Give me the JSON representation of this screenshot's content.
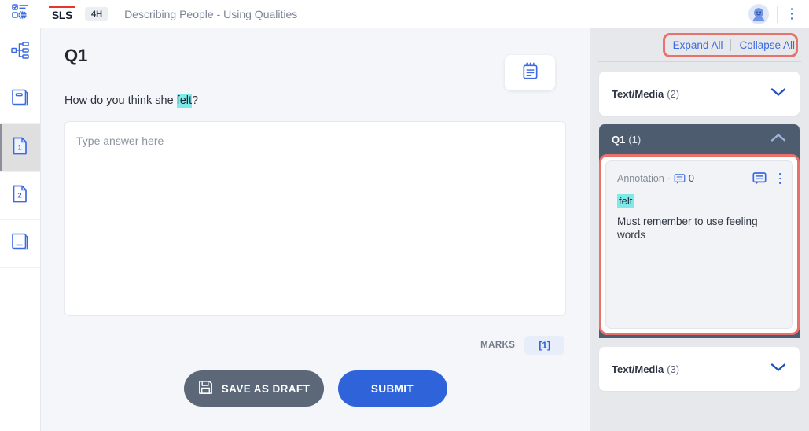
{
  "topbar": {
    "logo_icon": "sls-task-globe-icon",
    "brand": "SLS",
    "level_badge": "4H",
    "title": "Describing People - Using Qualities",
    "avatar_icon": "user-avatar-icon",
    "menu_icon": "kebab-menu-icon"
  },
  "leftnav": {
    "items": [
      {
        "icon": "hierarchy-tree-icon",
        "name": "sidebar-item-overview",
        "active": false
      },
      {
        "icon": "book-closed-icon",
        "name": "sidebar-item-cover",
        "active": false
      },
      {
        "icon": "page-1-icon",
        "name": "sidebar-item-page-1",
        "label": "1",
        "active": true
      },
      {
        "icon": "page-2-icon",
        "name": "sidebar-item-page-2",
        "label": "2",
        "active": false
      },
      {
        "icon": "book-open-icon",
        "name": "sidebar-item-resources",
        "active": false
      }
    ]
  },
  "main": {
    "question_label": "Q1",
    "notes_icon": "notepad-icon",
    "question_text_before": "How do you think she ",
    "question_highlight": "felt",
    "question_text_after": "?",
    "answer_placeholder": "Type answer here",
    "answer_value": "",
    "marks_label": "MARKS",
    "marks_value": "[1]",
    "save_draft_label": "SAVE AS DRAFT",
    "save_draft_icon": "floppy-disk-icon",
    "submit_label": "SUBMIT"
  },
  "rightpanel": {
    "expand_all": "Expand All",
    "collapse_all": "Collapse All",
    "sections": [
      {
        "title": "Text/Media",
        "count": "(2)",
        "state": "collapsed",
        "chevron": "chevron-down-icon"
      },
      {
        "title": "Q1",
        "count": "(1)",
        "state": "expanded",
        "chevron": "chevron-up-icon"
      },
      {
        "title": "Text/Media",
        "count": "(3)",
        "state": "collapsed",
        "chevron": "chevron-down-icon"
      }
    ],
    "annotation": {
      "label": "Annotation",
      "separator": "·",
      "comment_icon": "comment-bubble-icon",
      "comment_count": "0",
      "action_comment_icon": "comment-bubble-icon",
      "action_menu_icon": "kebab-menu-icon",
      "highlighted_term": "felt",
      "note_text": "Must remember to use feeling words"
    }
  },
  "colors": {
    "accent_blue": "#2f63da",
    "link_blue": "#3b6ae1",
    "highlight_cyan": "#7fe9e9",
    "highlight_red": "#e8726b",
    "section_header_slate": "#4e5c70",
    "draft_gray": "#5c6878",
    "panel_bg": "#e6e8ec",
    "main_bg": "#f4f6fa",
    "brand_red": "#e8342a"
  }
}
